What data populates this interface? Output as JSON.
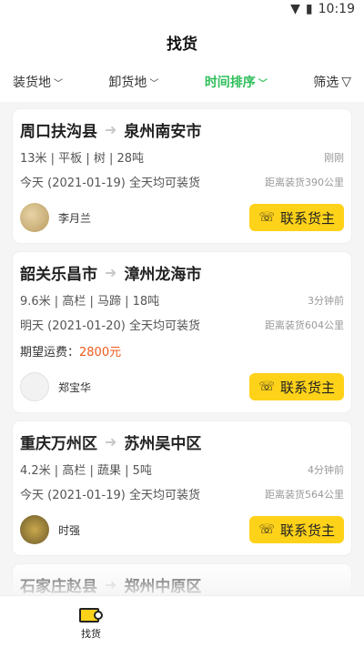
{
  "status_bar": {
    "time": "10:19",
    "icons": [
      "wifi-icon",
      "battery-icon"
    ]
  },
  "header": {
    "title": "找货"
  },
  "filters": [
    {
      "label": "装货地",
      "active": false,
      "icon": "chevron-down-icon"
    },
    {
      "label": "卸货地",
      "active": false,
      "icon": "chevron-down-icon"
    },
    {
      "label": "时间排序",
      "active": true,
      "icon": "chevron-down-icon"
    },
    {
      "label": "筛选",
      "active": false,
      "icon": "filter-icon"
    }
  ],
  "colors": {
    "accent_green": "#2fbf5b",
    "button_yellow": "#ffd21a",
    "price_orange": "#f05a1a"
  },
  "cards": [
    {
      "from": "周口扶沟县",
      "to": "泉州南安市",
      "specs": "13米 | 平板 | 树 | 28吨",
      "time_ago": "刚刚",
      "date_text": "今天 (2021-01-19) 全天均可装货",
      "distance": "距离装货390公里",
      "owner": "李月兰",
      "button": "联系货主"
    },
    {
      "from": "韶关乐昌市",
      "to": "漳州龙海市",
      "specs": "9.6米 | 高栏 | 马蹄 | 18吨",
      "time_ago": "3分钟前",
      "date_text": "明天 (2021-01-20) 全天均可装货",
      "distance": "距离装货604公里",
      "price_label": "期望运费：",
      "price_value": "2800元",
      "owner": "郑宝华",
      "button": "联系货主"
    },
    {
      "from": "重庆万州区",
      "to": "苏州吴中区",
      "specs": "4.2米 | 高栏 | 蔬果 | 5吨",
      "time_ago": "4分钟前",
      "date_text": "今天 (2021-01-19) 全天均可装货",
      "distance": "距离装货564公里",
      "owner": "时强",
      "button": "联系货主"
    },
    {
      "from": "石家庄赵县",
      "to": "郑州中原区"
    }
  ],
  "tabbar": {
    "items": [
      {
        "label": "找货",
        "icon": "find-goods-icon"
      }
    ]
  }
}
